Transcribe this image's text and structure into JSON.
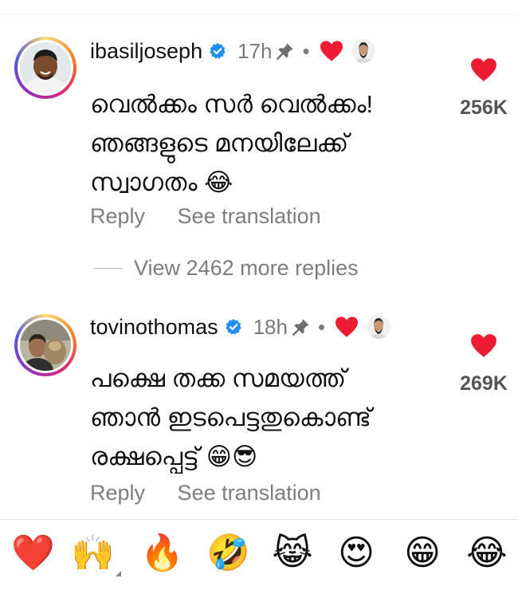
{
  "comments": [
    {
      "username": "ibasiljoseph",
      "time": "17h",
      "dot": "•",
      "text_lines": [
        "വെൽക്കം സർ വെൽക്കം!",
        "ഞങ്ങളുടെ മനയിലേക്ക്",
        "സ്വാഗതം 😂"
      ],
      "like_count": "256K",
      "reply_label": "Reply",
      "translate_label": "See translation"
    },
    {
      "username": "tovinothomas",
      "time": "18h",
      "dot": "•",
      "text_lines": [
        "പക്ഷെ തക്ക സമയത്ത്",
        "ഞാൻ ഇടപെട്ടതുകൊണ്ട്",
        "രക്ഷപ്പെട്ട് 😁😎"
      ],
      "like_count": "269K",
      "reply_label": "Reply",
      "translate_label": "See translation"
    }
  ],
  "view_replies": "View 2462 more replies",
  "quick_reactions": [
    "❤️",
    "🙌",
    "🔥",
    "🤣",
    "😹",
    "😍",
    "😁",
    "😂"
  ],
  "colors": {
    "heart": "#ed1c33",
    "verified": "#1f8ff5",
    "secondary_text": "#7d7d7d"
  },
  "icons": {
    "verified": "verified-badge-icon",
    "pin": "pin-icon",
    "heart": "heart-icon"
  }
}
